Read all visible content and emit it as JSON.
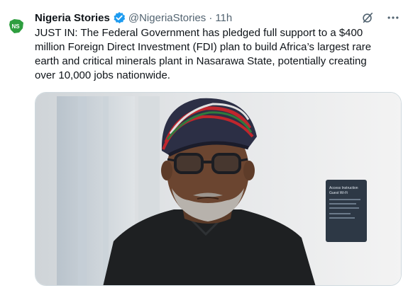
{
  "tweet": {
    "author": {
      "name": "Nigeria Stories",
      "handle": "@NigeriaStories",
      "verified": true,
      "avatar_icon": "nigeria-map-logo-icon",
      "avatar_text": "NS"
    },
    "separator": "·",
    "time": "11h",
    "text": "JUST IN: The Federal Government has pledged full support to a $400\nmillion Foreign Direct Investment (FDI) plan to build Africa’s largest rare\nearth and critical minerals plant in Nasarawa State, potentially creating\nover 10,000  jobs  nationwide.",
    "media": {
      "description_icon": "photo-of-man-in-cap-and-glasses",
      "sign_lines": [
        "Access Instruction",
        "Guest Wi-Fi"
      ]
    },
    "header_icons": [
      "grok-icon",
      "more-icon"
    ]
  },
  "colors": {
    "verified_blue": "#1d9bf0",
    "secondary_text": "#536471",
    "avatar_green": "#2e9e3f"
  }
}
